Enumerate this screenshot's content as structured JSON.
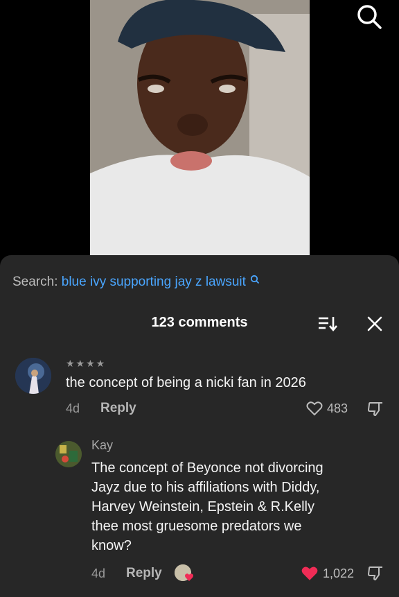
{
  "search": {
    "label": "Search:",
    "query": "blue ivy supporting jay z lawsuit"
  },
  "comments_header": {
    "count_label": "123 comments"
  },
  "comments": [
    {
      "stars": "★★★★",
      "text": "the concept of being a nicki fan in 2026",
      "age": "4d",
      "reply_label": "Reply",
      "likes": "483",
      "liked": false
    },
    {
      "username": "Kay",
      "text_lines": [
        "The concept of Beyonce not divorcing",
        "Jayz due to his affiliations with Diddy,",
        "Harvey Weinstein, Epstein & R.Kelly",
        "thee most gruesome predators we",
        "know?"
      ],
      "age": "4d",
      "reply_label": "Reply",
      "likes": "1,022",
      "liked": true
    }
  ],
  "colors": {
    "accent_link": "#4aa6ff",
    "liked_heart": "#f02c56",
    "sheet_bg": "#272727"
  },
  "icons": [
    "search-icon",
    "sort-icon",
    "close-icon",
    "heart-icon",
    "dislike-icon"
  ]
}
